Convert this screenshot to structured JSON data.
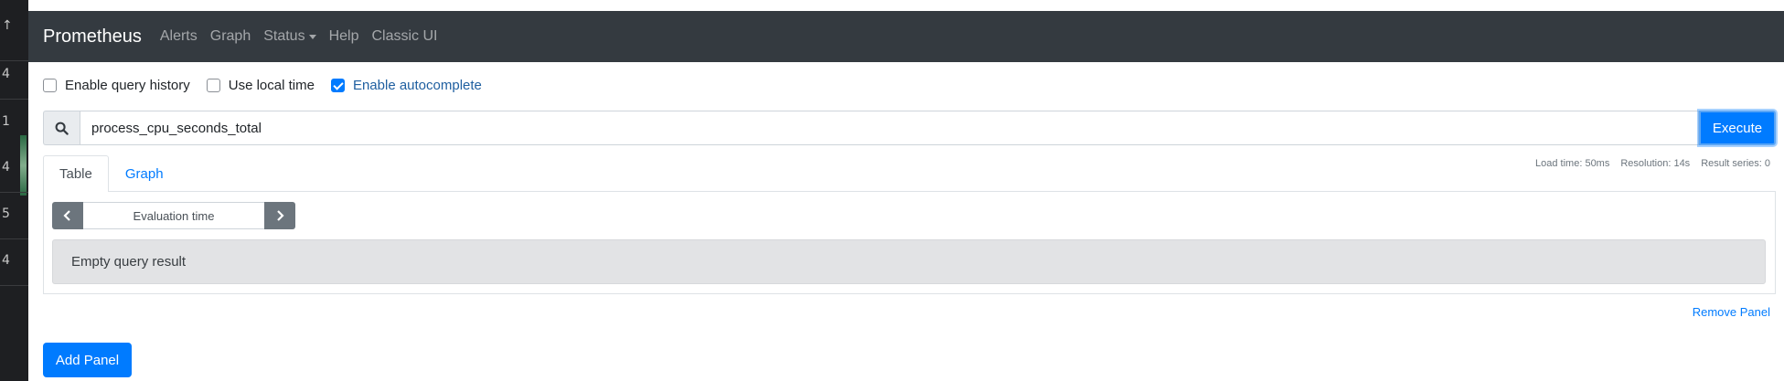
{
  "navbar": {
    "brand": "Prometheus",
    "links": [
      "Alerts",
      "Graph",
      "Status",
      "Help",
      "Classic UI"
    ]
  },
  "left_strip": {
    "numbers": [
      "4",
      "1",
      "4",
      "5",
      "4"
    ]
  },
  "options": {
    "query_history": {
      "label": "Enable query history",
      "checked": false
    },
    "local_time": {
      "label": "Use local time",
      "checked": false
    },
    "autocomplete": {
      "label": "Enable autocomplete",
      "checked": true
    }
  },
  "query": {
    "value": "process_cpu_seconds_total",
    "execute_label": "Execute"
  },
  "tabs": [
    "Table",
    "Graph"
  ],
  "stats": {
    "load_time": "Load time: 50ms",
    "resolution": "Resolution: 14s",
    "result_series": "Result series: 0"
  },
  "table": {
    "evaluation_placeholder": "Evaluation time",
    "empty_message": "Empty query result"
  },
  "remove_panel": "Remove Panel",
  "add_panel": "Add Panel",
  "colors": {
    "navbar": "#343a40",
    "primary": "#007bff",
    "secondary": "#6c757d",
    "empty_result_bg": "#e2e3e5"
  }
}
